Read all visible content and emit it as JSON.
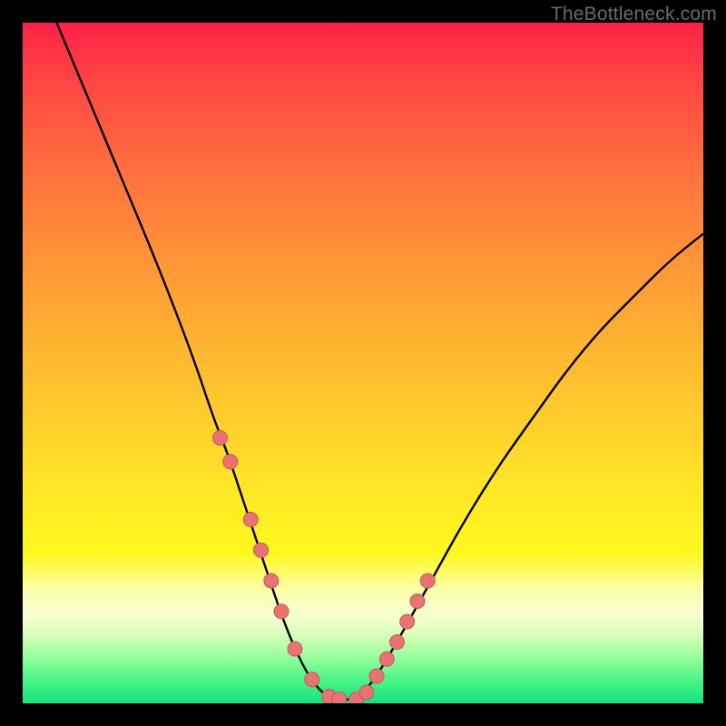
{
  "watermark": "TheBottleneck.com",
  "colors": {
    "background": "#000000",
    "curve_stroke": "#000000",
    "marker_fill": "#e97373",
    "marker_stroke": "#c55a5a"
  },
  "chart_data": {
    "type": "line",
    "title": "",
    "xlabel": "",
    "ylabel": "",
    "xlim": [
      0,
      100
    ],
    "ylim": [
      0,
      100
    ],
    "grid": false,
    "legend": false,
    "series": [
      {
        "name": "curve",
        "x": [
          5,
          10,
          15,
          20,
          25,
          28,
          30,
          32,
          34,
          36,
          38,
          40,
          42,
          44,
          46,
          48,
          50,
          52,
          55,
          60,
          65,
          70,
          75,
          80,
          85,
          90,
          95,
          100
        ],
        "values": [
          100,
          88,
          76,
          64,
          51,
          42,
          37,
          31,
          25,
          19,
          13,
          8,
          4,
          1.5,
          0.5,
          0.5,
          1.5,
          4,
          9,
          18,
          27,
          35,
          42,
          49,
          55,
          60,
          65,
          69
        ]
      }
    ],
    "markers": {
      "name": "dots",
      "x": [
        29.0,
        30.5,
        33.5,
        35.0,
        36.5,
        38.0,
        40.0,
        42.5,
        45.0,
        46.5,
        49.0,
        50.5,
        52.0,
        53.5,
        55.0,
        56.5,
        58.0,
        59.5
      ],
      "values": [
        39.0,
        35.5,
        27.0,
        22.5,
        18.0,
        13.5,
        8.0,
        3.5,
        1.0,
        0.6,
        0.6,
        1.6,
        4.0,
        6.5,
        9.0,
        12.0,
        15.0,
        18.0
      ]
    }
  }
}
